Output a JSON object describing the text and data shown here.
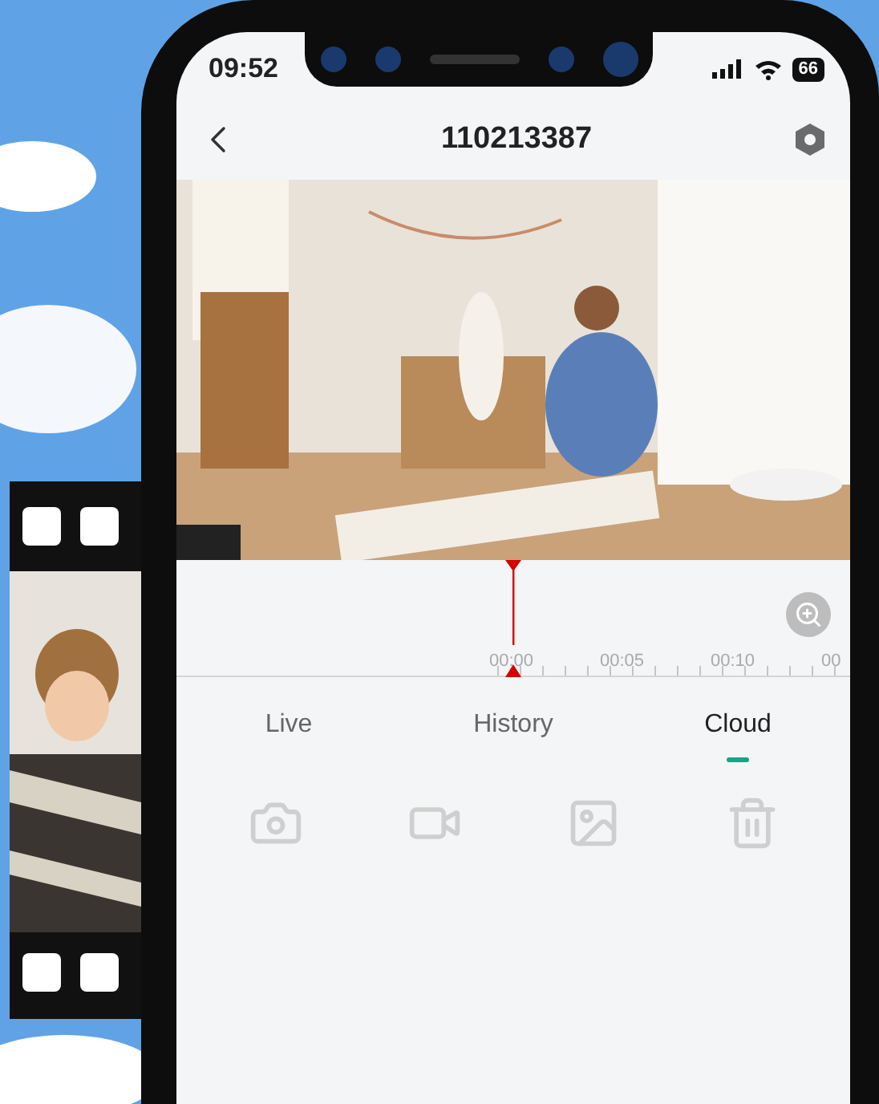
{
  "status_bar": {
    "time": "09:52",
    "battery": "66"
  },
  "header": {
    "title": "110213387"
  },
  "timeline": {
    "labels": [
      "00:00",
      "00:05",
      "00:10",
      "00"
    ]
  },
  "tabs": [
    {
      "label": "Live",
      "selected": false
    },
    {
      "label": "History",
      "selected": false
    },
    {
      "label": "Cloud",
      "selected": true
    }
  ],
  "actions": [
    {
      "kind": "camera",
      "disabled": true
    },
    {
      "kind": "video",
      "disabled": true
    },
    {
      "kind": "gallery",
      "disabled": true
    },
    {
      "kind": "delete",
      "disabled": true
    }
  ]
}
